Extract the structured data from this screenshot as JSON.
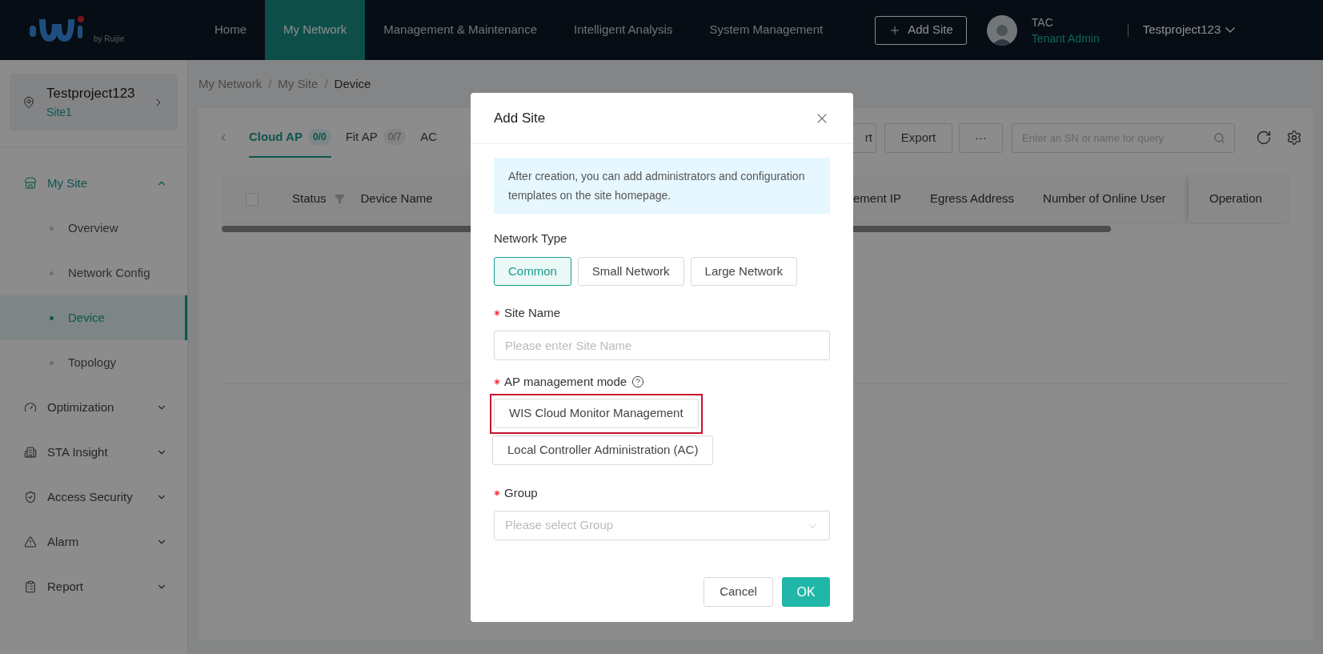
{
  "top_nav": {
    "logo_caption": "by Ruijie",
    "items": [
      {
        "label": "Home",
        "selected": false
      },
      {
        "label": "My Network",
        "selected": true
      },
      {
        "label": "Management & Maintenance",
        "selected": false
      },
      {
        "label": "Intelligent Analysis",
        "selected": false
      },
      {
        "label": "System Management",
        "selected": false
      }
    ],
    "add_site_button": "Add Site",
    "user": {
      "name": "TAC",
      "role": "Tenant Admin"
    },
    "project": "Testproject123"
  },
  "sidebar": {
    "project": {
      "name": "Testproject123",
      "site": "Site1"
    },
    "items": [
      {
        "label": "My Site",
        "expanded": true,
        "children": [
          {
            "label": "Overview",
            "selected": false
          },
          {
            "label": "Network Config",
            "selected": false
          },
          {
            "label": "Device",
            "selected": true
          },
          {
            "label": "Topology",
            "selected": false
          }
        ]
      },
      {
        "label": "Optimization",
        "expanded": false
      },
      {
        "label": "STA Insight",
        "expanded": false
      },
      {
        "label": "Access Security",
        "expanded": false
      },
      {
        "label": "Alarm",
        "expanded": false
      },
      {
        "label": "Report",
        "expanded": false
      }
    ]
  },
  "breadcrumb": [
    "My Network",
    "My Site",
    "Device"
  ],
  "breadcrumb_separator": "/",
  "device_tabs": [
    {
      "label": "Cloud AP",
      "count": "0/0",
      "selected": true
    },
    {
      "label": "Fit AP",
      "count": "0/7",
      "selected": false
    },
    {
      "label": "AC",
      "selected": false
    }
  ],
  "toolbar": {
    "buttons": [
      "rt",
      "Export",
      "···"
    ],
    "search": {
      "placeholder": "Enter an SN or name for query"
    }
  },
  "table": {
    "select_all_checked": false,
    "columns_left": [
      "Status",
      "Device Name"
    ],
    "columns_right": [
      "ement IP",
      "Egress Address",
      "Number of Online User"
    ],
    "fixed_column": "Operation"
  },
  "dialog": {
    "title": "Add Site",
    "info": "After creation, you can add administrators and configuration templates on the site homepage.",
    "network_type": {
      "label": "Network Type",
      "options": [
        {
          "label": "Common",
          "selected": true
        },
        {
          "label": "Small Network",
          "selected": false
        },
        {
          "label": "Large Network",
          "selected": false
        }
      ]
    },
    "site_name": {
      "label": "Site Name",
      "required": true,
      "placeholder": "Please enter Site Name"
    },
    "ap_mode": {
      "label": "AP management mode",
      "required": true,
      "options": [
        {
          "label": "WIS Cloud Monitor Management",
          "highlighted": true
        },
        {
          "label": "Local Controller Administration (AC)",
          "highlighted": false
        }
      ]
    },
    "group": {
      "label": "Group",
      "required": true,
      "placeholder": "Please select Group"
    },
    "cancel_button": "Cancel",
    "ok_button": "OK"
  }
}
